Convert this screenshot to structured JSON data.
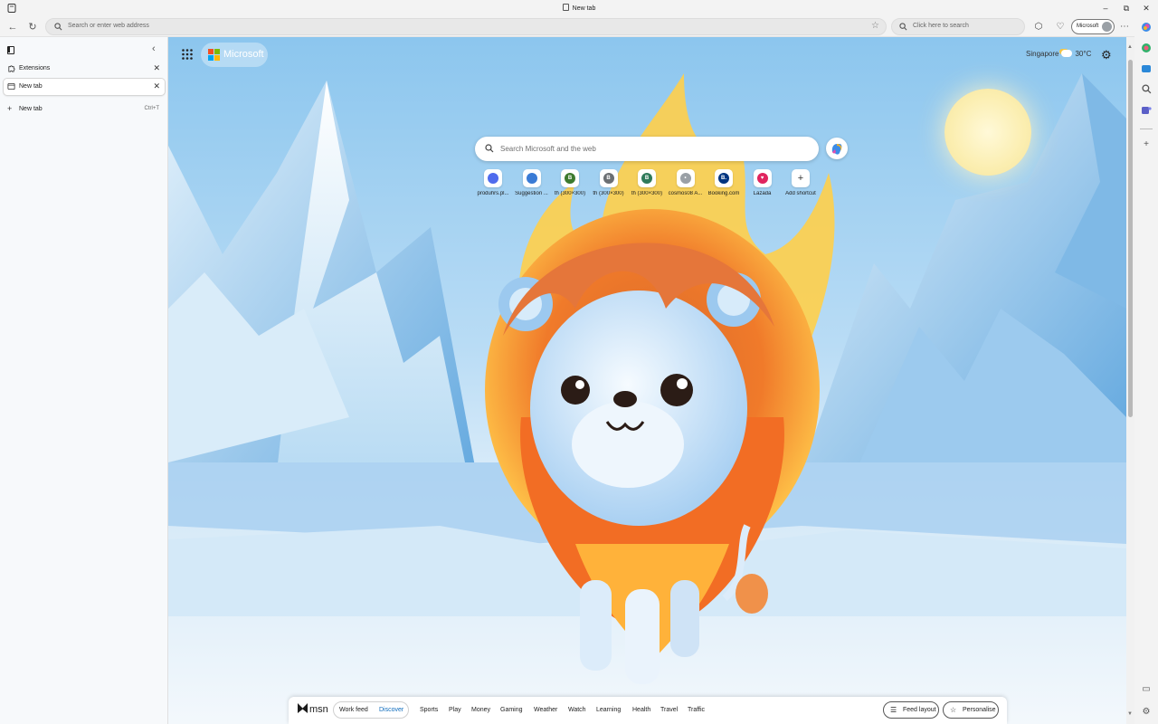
{
  "window": {
    "title": "New tab",
    "controls": [
      "minimize",
      "restore",
      "close"
    ]
  },
  "toolbar": {
    "address_placeholder": "Search or enter web address",
    "search_placeholder": "Click here to search",
    "profile_label": "Microsoft"
  },
  "tabs_panel": {
    "items": [
      {
        "label": "Extensions",
        "active": false
      },
      {
        "label": "New tab",
        "active": true
      }
    ],
    "new_tab_label": "New tab",
    "new_tab_shortcut": "Ctrl+T"
  },
  "newtab": {
    "brand": "Microsoft",
    "weather": {
      "city": "Singapore",
      "temp": "30°C"
    },
    "search_placeholder": "Search Microsoft and the web",
    "shortcuts": [
      {
        "label": "produhrs.pl...",
        "letter": "",
        "color": "#4f6bed"
      },
      {
        "label": "Suggestion ...",
        "letter": "",
        "color": "#3a7bd5"
      },
      {
        "label": "th (300×300)",
        "letter": "B",
        "color": "#3d7a2e"
      },
      {
        "label": "th (300×300)",
        "letter": "B",
        "color": "#6b6f73"
      },
      {
        "label": "th (300×300)",
        "letter": "B",
        "color": "#2f7a5a"
      },
      {
        "label": "cosmos08 A...",
        "letter": "•",
        "color": "#9aa0a6"
      },
      {
        "label": "Booking.com",
        "letter": "B.",
        "color": "#003580"
      },
      {
        "label": "Lazada",
        "letter": "♥",
        "color": "#e0245e"
      },
      {
        "label": "Add shortcut",
        "letter": "+",
        "color": "#ffffff"
      }
    ]
  },
  "msn": {
    "logo": "msn",
    "feed_tabs": [
      "Work feed",
      "Discover"
    ],
    "active_feed": "Discover",
    "categories": [
      "Sports",
      "Play",
      "Money",
      "Gaming",
      "Weather",
      "Watch",
      "Learning",
      "Health",
      "Travel",
      "Traffic"
    ],
    "feed_layout_label": "Feed layout",
    "personalise_label": "Personalise"
  },
  "colors": {
    "accent": "#0f6cbd",
    "sky": "#8cc6ee",
    "mane": "#f07a2a"
  }
}
